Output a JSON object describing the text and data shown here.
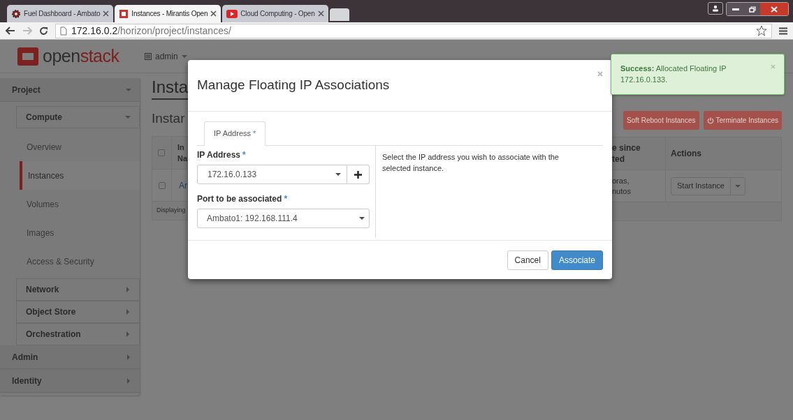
{
  "browser": {
    "tabs": [
      {
        "title": "Fuel Dashboard - Ambato",
        "kind": "gear",
        "selected": false
      },
      {
        "title": "Instances - Mirantis Open",
        "kind": "square",
        "selected": true
      },
      {
        "title": "Cloud Computing - Open",
        "kind": "video",
        "selected": false
      }
    ],
    "url": {
      "host": "172.16.0.2",
      "path": "/horizon/project/instances/"
    }
  },
  "header": {
    "logo": {
      "light": "open",
      "accent": "stack"
    },
    "project_menu": "admin"
  },
  "sidebar": [
    {
      "label": "Project",
      "expanded": true,
      "children": [
        {
          "label": "Compute",
          "expanded": true,
          "children": [
            {
              "label": "Overview",
              "selected": false
            },
            {
              "label": "Instances",
              "selected": true
            },
            {
              "label": "Volumes",
              "selected": false
            },
            {
              "label": "Images",
              "selected": false
            },
            {
              "label": "Access & Security",
              "selected": false
            }
          ]
        },
        {
          "label": "Network",
          "expanded": false
        },
        {
          "label": "Object Store",
          "expanded": false
        },
        {
          "label": "Orchestration",
          "expanded": false
        }
      ]
    },
    {
      "label": "Admin",
      "expanded": false
    },
    {
      "label": "Identity",
      "expanded": false
    }
  ],
  "content": {
    "heading": "Insta",
    "subheading": "Instar",
    "buttons": [
      {
        "label": "Soft Reboot Instances",
        "kind": "plain"
      },
      {
        "label": "Terminate Instances",
        "kind": "power"
      }
    ],
    "table": {
      "left_columns": [
        {
          "lines": [
            "In",
            "Na"
          ]
        }
      ],
      "right_columns": [
        {
          "lines": [
            "e since",
            "ted"
          ]
        },
        {
          "lines": [
            "Actions"
          ]
        }
      ],
      "rows": [
        {
          "checked": false,
          "name": "Ar",
          "time": [
            "oras,",
            "nutos"
          ],
          "action": "Start Instance"
        }
      ],
      "header_checked": false,
      "footer": "Displaying"
    }
  },
  "modal": {
    "title": "Manage Floating IP Associations",
    "tabs": [
      {
        "label": "IP Address",
        "mark": "*",
        "selected": true
      }
    ],
    "fields": [
      {
        "kind": "select_add",
        "label": "IP Address",
        "mark": "*",
        "value": "172.16.0.133"
      },
      {
        "kind": "select",
        "label": "Port to be associated",
        "mark": "*",
        "value": "Ambato1: 192.168.111.4"
      }
    ],
    "help": "Select the IP address you wish to associate with the selected instance.",
    "buttons": [
      {
        "label": "Cancel",
        "kind": "default"
      },
      {
        "label": "Associate",
        "kind": "primary"
      }
    ]
  },
  "toast": {
    "message": "**Success:** Allocated Floating IP 172.16.0.133."
  }
}
